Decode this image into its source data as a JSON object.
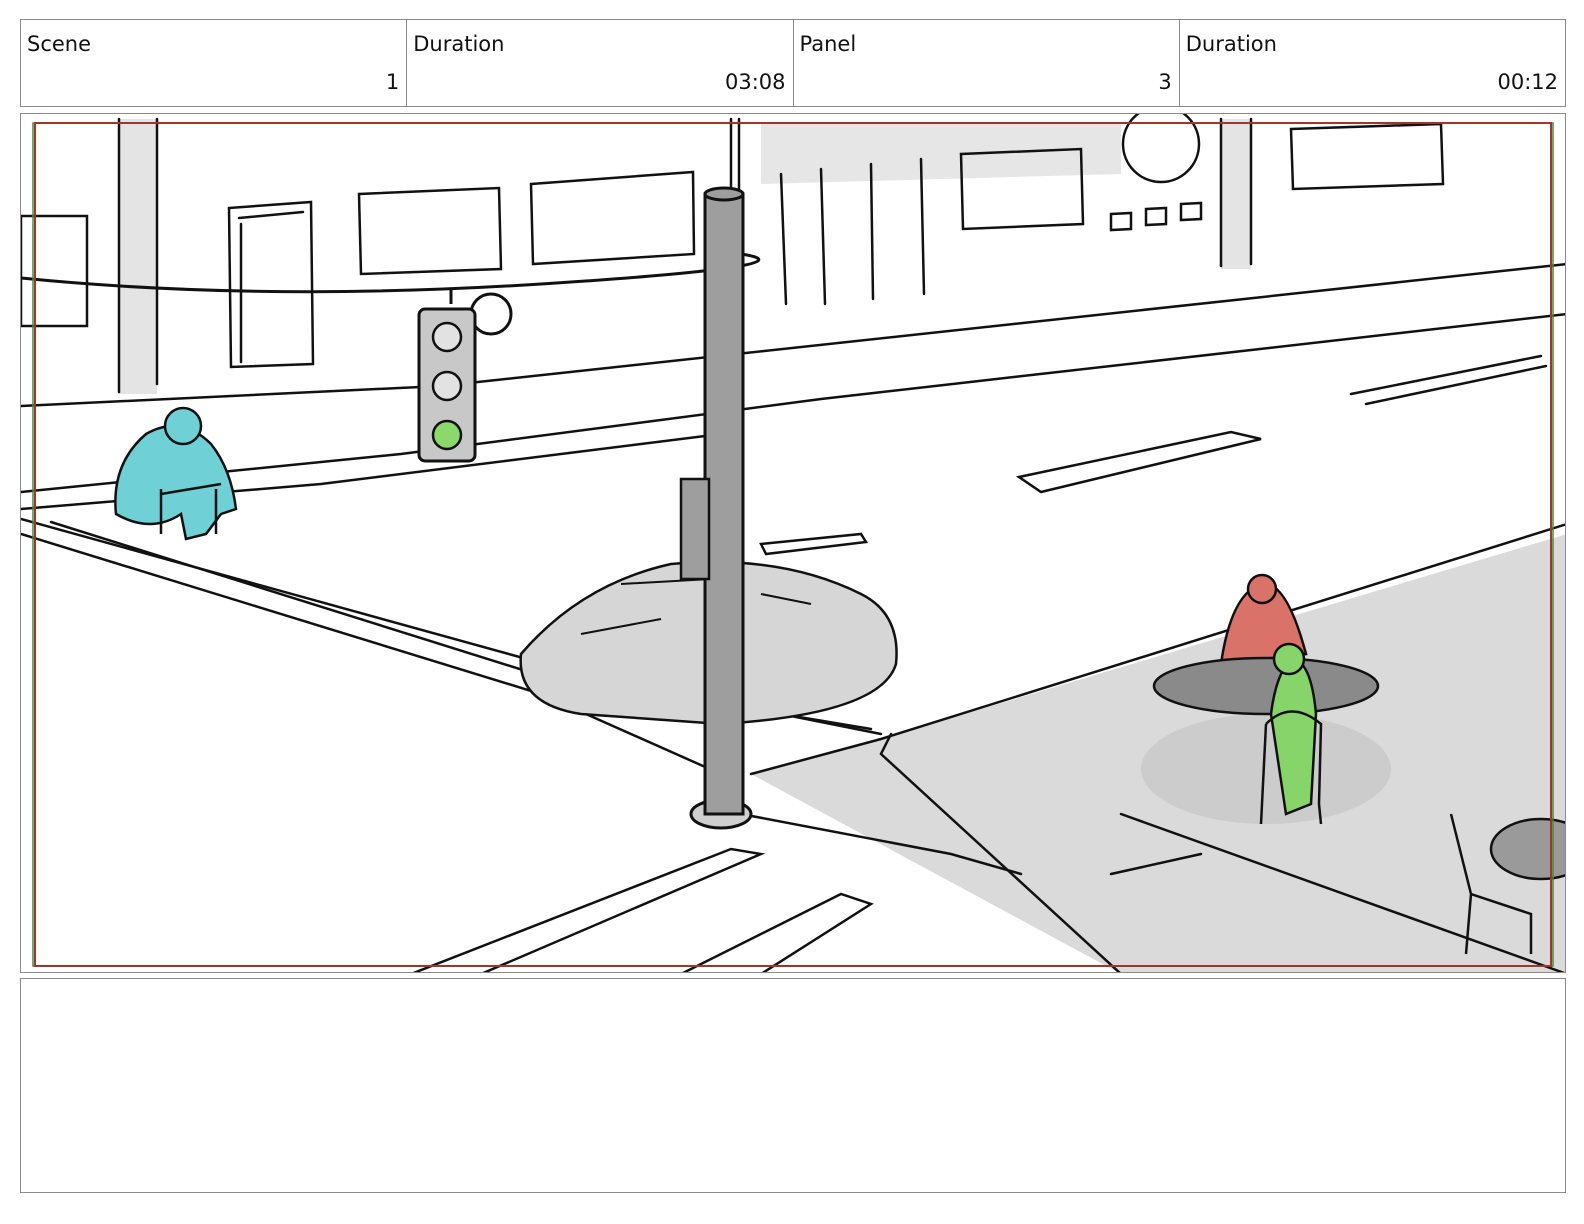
{
  "header": {
    "scene_label": "Scene",
    "scene_value": "1",
    "scene_duration_label": "Duration",
    "scene_duration_value": "03:08",
    "panel_label": "Panel",
    "panel_value": "3",
    "panel_duration_label": "Duration",
    "panel_duration_value": "00:12"
  },
  "colors": {
    "safe_frame_red": "#a0352b",
    "safe_frame_green": "#3f8f3f",
    "pedestrian_cyan": "#6fd0d6",
    "person_red": "#d9736a",
    "person_green": "#86d46a",
    "signal_light_green": "#8cd86a"
  },
  "notes": {
    "text": ""
  }
}
